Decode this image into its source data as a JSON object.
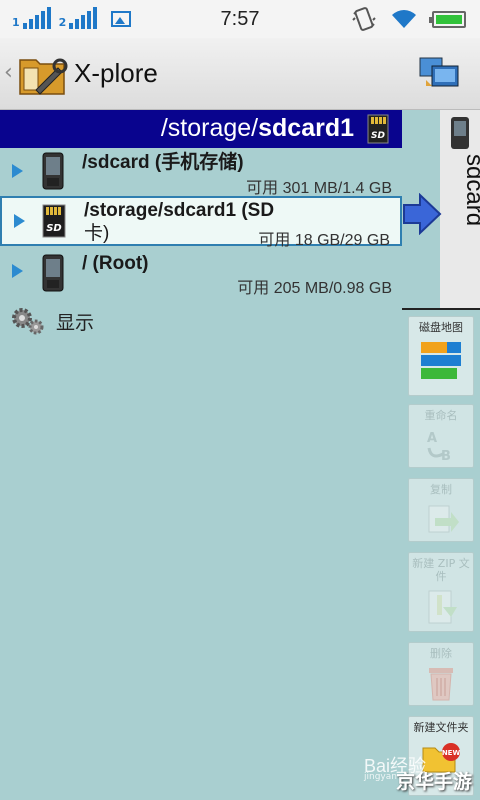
{
  "status_bar": {
    "sim1_label": "1",
    "sim2_label": "2",
    "time": "7:57",
    "icons": [
      "signal-icon",
      "signal-icon",
      "image-icon",
      "vibrate-icon",
      "wifi-icon",
      "battery-icon"
    ]
  },
  "app_bar": {
    "title": "X-plore"
  },
  "path_bar": {
    "prefix": "/storage/",
    "bold": "sdcard1"
  },
  "list": [
    {
      "name": "/sdcard (手机存储)",
      "size": "可用 301 MB/1.4 GB",
      "icon": "phone-icon",
      "selected": false
    },
    {
      "name_line1": "/storage/sdcard1 (SD",
      "name_line2": "卡)",
      "size": "可用 18 GB/29 GB",
      "icon": "sd-card-icon",
      "selected": true
    },
    {
      "name": "/ (Root)",
      "size": "可用 205 MB/0.98 GB",
      "icon": "phone-icon",
      "selected": false
    }
  ],
  "show_label": "显示",
  "device_tab": {
    "label": "sdcard"
  },
  "toolbar": [
    {
      "label": "磁盘地图",
      "enabled": true
    },
    {
      "label": "重命名",
      "enabled": false
    },
    {
      "label": "复制",
      "enabled": false
    },
    {
      "label": "新建 ZIP 文件",
      "enabled": false
    },
    {
      "label": "删除",
      "enabled": false
    },
    {
      "label": "新建文件夹",
      "enabled": true
    }
  ],
  "watermark": {
    "brand": "Bai经验",
    "site": "jingyan",
    "cn": "京华手游"
  },
  "colors": {
    "path_bar_bg": "#09048e",
    "panel_bg": "#a9cfd0",
    "selected_row_bg": "#eef9f6",
    "arrow_blue": "#2c8bd0"
  }
}
